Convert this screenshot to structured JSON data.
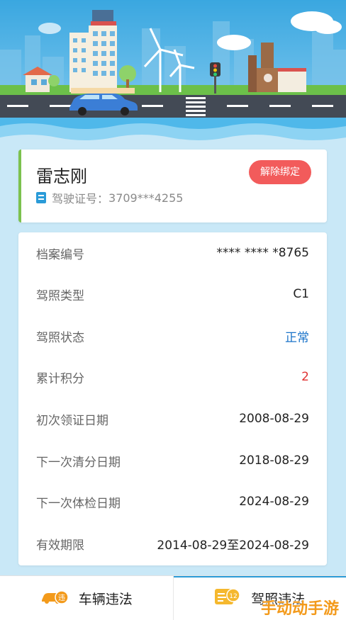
{
  "profile": {
    "name": "雷志刚",
    "license_label": "驾驶证号：",
    "license_number": "3709***4255",
    "unbind_label": "解除绑定"
  },
  "details": [
    {
      "label": "档案编号",
      "value": "**** **** *8765"
    },
    {
      "label": "驾照类型",
      "value": "C1"
    },
    {
      "label": "驾照状态",
      "value": "正常",
      "value_color": "#1a73c9"
    },
    {
      "label": "累计积分",
      "value": "2",
      "value_color": "#e03131"
    },
    {
      "label": "初次领证日期",
      "value": "2008-08-29"
    },
    {
      "label": "下一次清分日期",
      "value": "2018-08-29"
    },
    {
      "label": "下一次体检日期",
      "value": "2024-08-29"
    },
    {
      "label": "有效期限",
      "value": "2014-08-29至2024-08-29"
    }
  ],
  "tabs": [
    {
      "label": "车辆违法",
      "icon": "car-violation-icon"
    },
    {
      "label": "驾照违法",
      "icon": "license-violation-icon",
      "active": true
    }
  ],
  "watermark": "手动动手游",
  "colors": {
    "accent": "#2a9bd8",
    "unbind": "#f25b5b",
    "status_normal": "#1a73c9",
    "points": "#e03131",
    "card_border": "#7cc24e"
  }
}
